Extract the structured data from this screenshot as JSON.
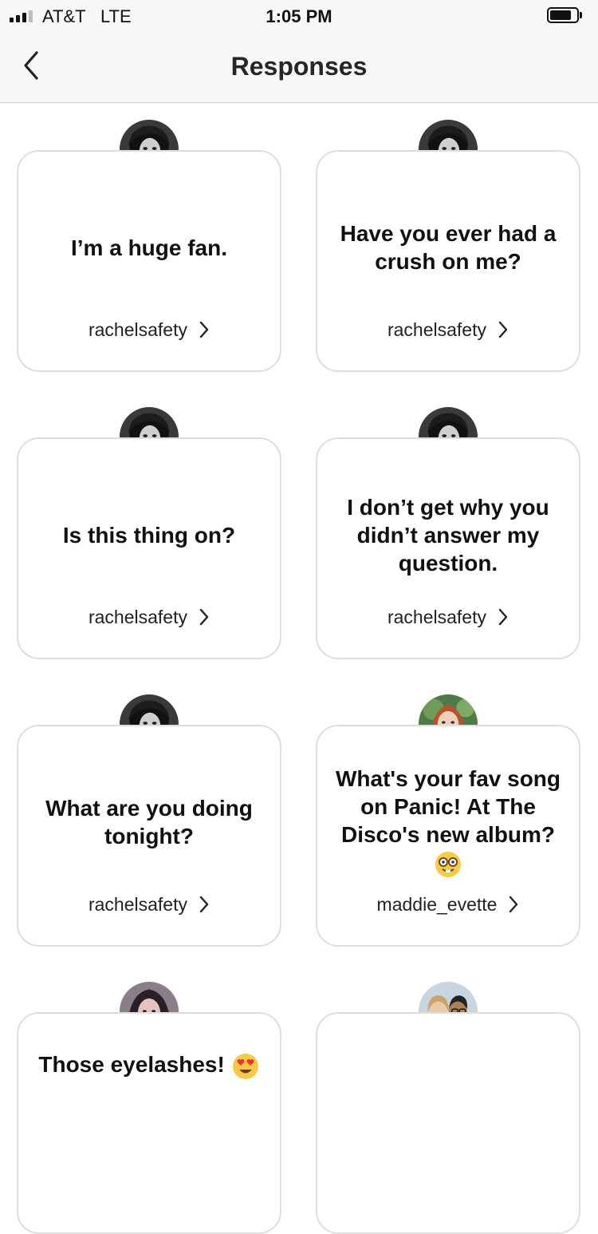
{
  "status_bar": {
    "carrier": "AT&T",
    "network": "LTE",
    "time": "1:05 PM"
  },
  "header": {
    "title": "Responses"
  },
  "cards": [
    {
      "question": "I’m a huge fan.",
      "username": "rachelsafety",
      "avatar": "bw-portrait"
    },
    {
      "question": "Have you ever had a crush on me?",
      "username": "rachelsafety",
      "avatar": "bw-portrait"
    },
    {
      "question": "Is this thing on?",
      "username": "rachelsafety",
      "avatar": "bw-portrait"
    },
    {
      "question": "I don’t get why you didn’t answer my question.",
      "username": "rachelsafety",
      "avatar": "bw-portrait"
    },
    {
      "question": "What are you doing tonight?",
      "username": "rachelsafety",
      "avatar": "bw-portrait"
    },
    {
      "question": "What's your fav song on Panic! At The Disco's new album?",
      "username": "maddie_evette",
      "avatar": "redhead-portrait",
      "emoji": "nerd-face-emoji"
    },
    {
      "question": "Those eyelashes!",
      "username": "",
      "avatar": "dark-hair-portrait",
      "emoji": "heart-eyes-emoji"
    },
    {
      "question": "",
      "username": "",
      "avatar": "couple-portrait"
    }
  ]
}
